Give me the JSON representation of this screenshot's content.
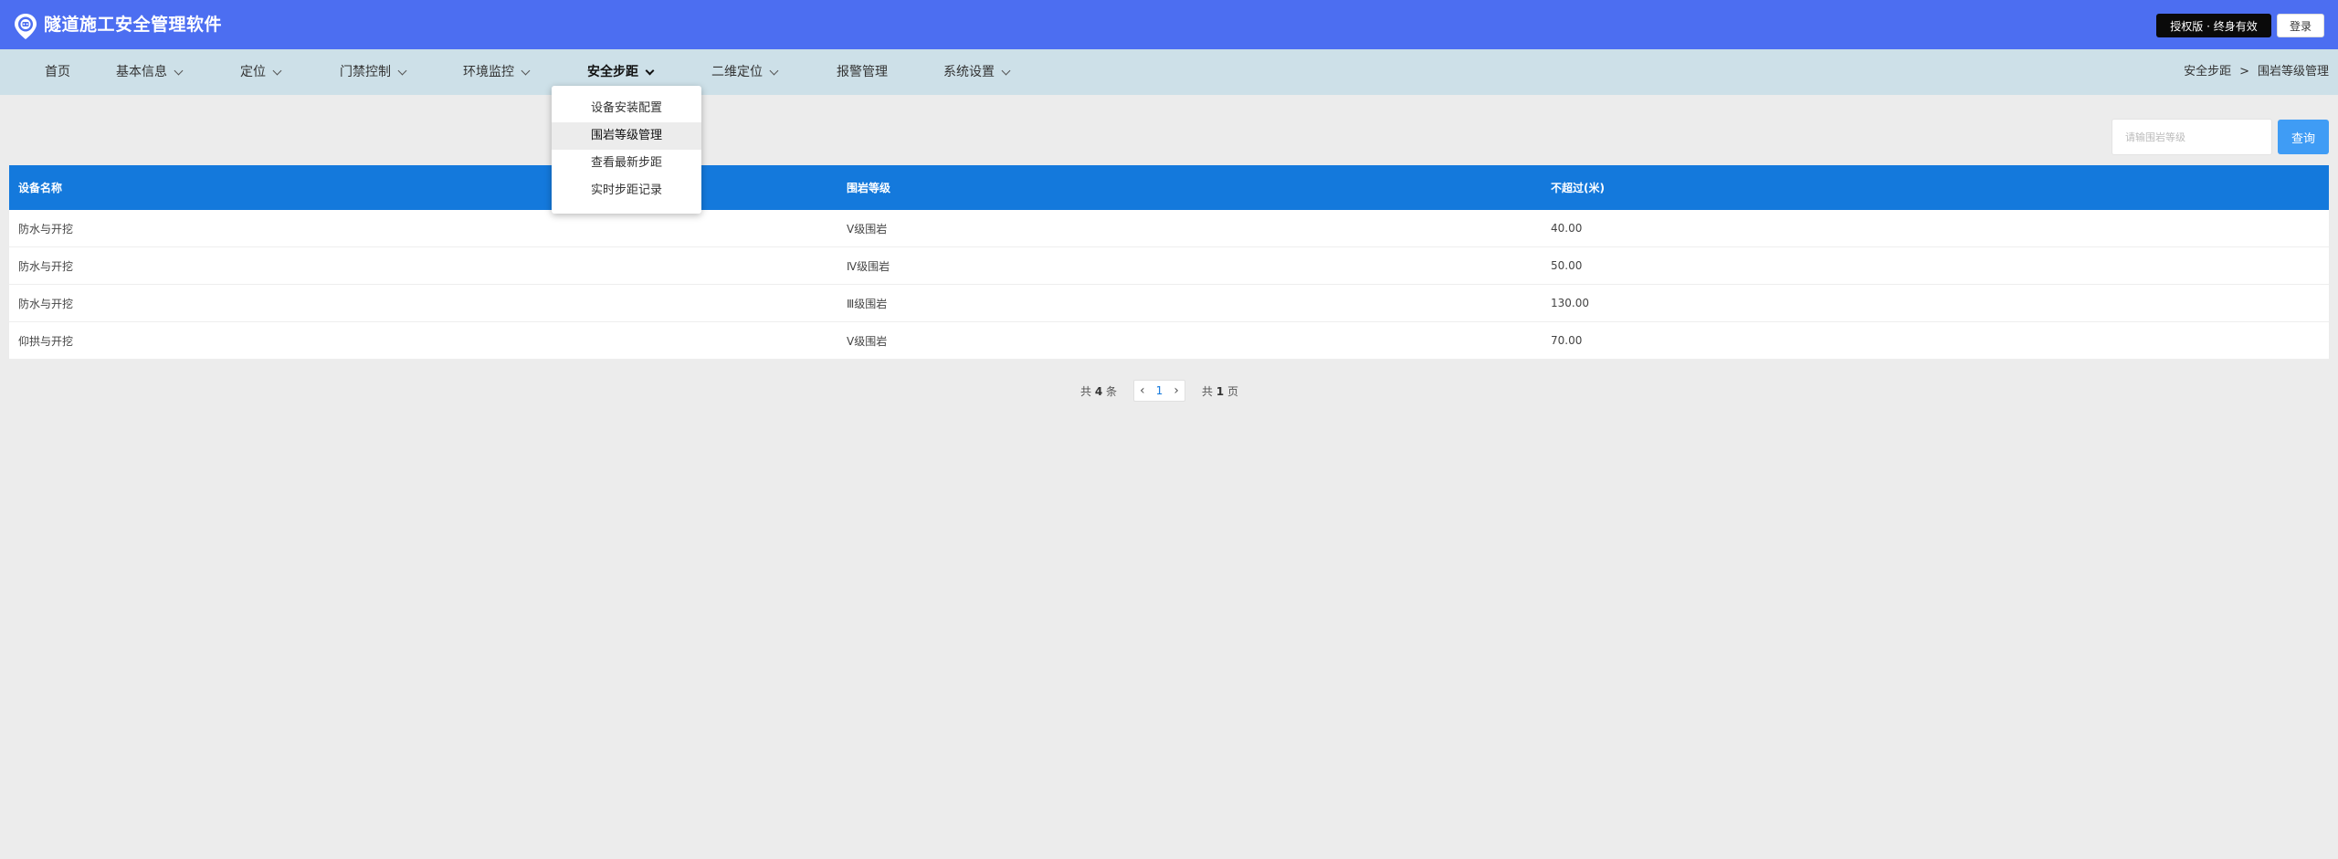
{
  "header": {
    "title": "隧道施工安全管理软件",
    "license_badge": "授权版 · 终身有效",
    "login_label": "登录"
  },
  "colors": {
    "header_bg": "#4c6ef1",
    "nav_bg": "#cde0e8",
    "table_header_bg": "#1479dc",
    "search_button_bg": "#3f9cf5"
  },
  "nav": {
    "items": [
      {
        "label": "首页",
        "has_dropdown": false
      },
      {
        "label": "基本信息",
        "has_dropdown": true
      },
      {
        "label": "定位",
        "has_dropdown": true
      },
      {
        "label": "门禁控制",
        "has_dropdown": true
      },
      {
        "label": "环境监控",
        "has_dropdown": true
      },
      {
        "label": "安全步距",
        "has_dropdown": true,
        "active": true
      },
      {
        "label": "二维定位",
        "has_dropdown": true
      },
      {
        "label": "报警管理",
        "has_dropdown": false
      },
      {
        "label": "系统设置",
        "has_dropdown": true
      }
    ]
  },
  "breadcrumb": {
    "parent": "安全步距",
    "separator": ">",
    "current": "围岩等级管理"
  },
  "dropdown": {
    "items": [
      {
        "label": "设备安装配置",
        "selected": false
      },
      {
        "label": "围岩等级管理",
        "selected": true
      },
      {
        "label": "查看最新步距",
        "selected": false
      },
      {
        "label": "实时步距记录",
        "selected": false
      }
    ]
  },
  "search": {
    "placeholder": "请输围岩等级",
    "button_label": "查询"
  },
  "table": {
    "columns": [
      "设备名称",
      "围岩等级",
      "不超过(米)"
    ],
    "rows": [
      [
        "防水与开挖",
        "Ⅴ级围岩",
        "40.00"
      ],
      [
        "防水与开挖",
        "Ⅳ级围岩",
        "50.00"
      ],
      [
        "防水与开挖",
        "Ⅲ级围岩",
        "130.00"
      ],
      [
        "仰拱与开挖",
        "Ⅴ级围岩",
        "70.00"
      ]
    ]
  },
  "pagination": {
    "total_prefix": "共",
    "total_count": "4",
    "total_suffix": "条",
    "current_page": "1",
    "pages_prefix": "共",
    "pages_count": "1",
    "pages_suffix": "页"
  }
}
